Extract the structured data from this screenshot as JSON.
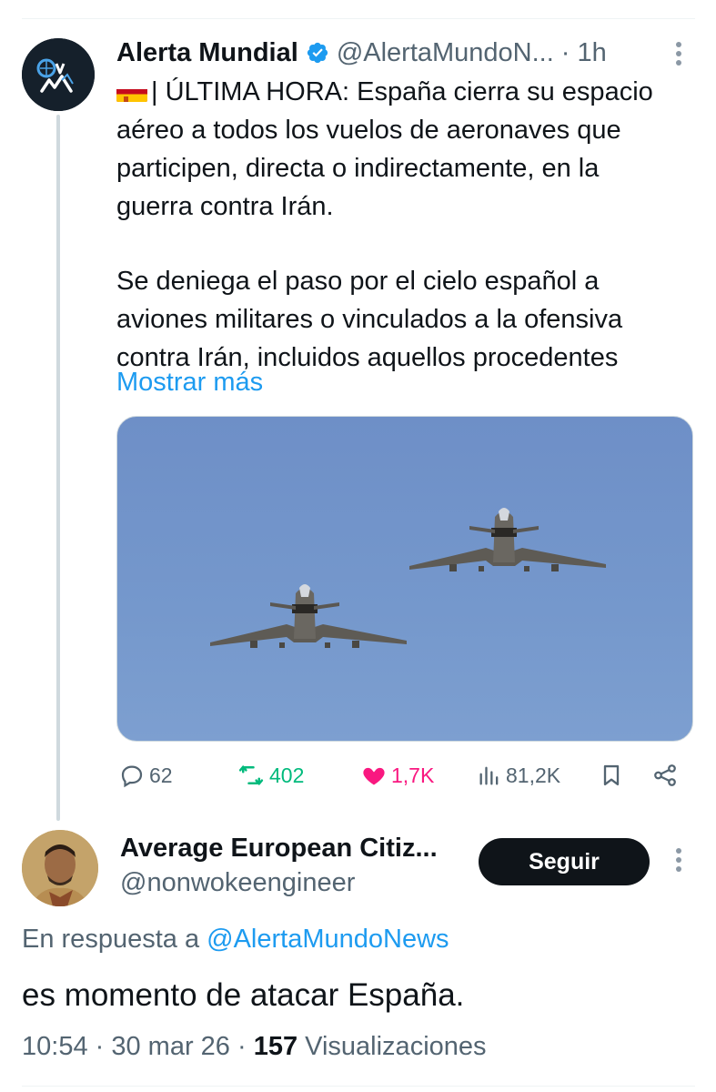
{
  "tweet": {
    "author_name": "Alerta Mundial",
    "author_handle": "@AlertaMundoN...",
    "separator": "·",
    "time": "1h",
    "text_line1": "| ÚLTIMA HORA: España cierra su espacio",
    "text_line2": "aéreo a todos los vuelos de aeronaves que",
    "text_line3": "participen, directa o indirectamente, en la",
    "text_line4": "guerra contra Irán.",
    "text_line5": "Se deniega el paso por el cielo español a",
    "text_line6": "aviones militares o vinculados a la ofensiva",
    "text_line7": "contra Irán, incluidos aquellos procedentes",
    "show_more": "Mostrar más",
    "replies": "62",
    "reposts": "402",
    "likes": "1,7K",
    "views": "81,2K"
  },
  "reply": {
    "author_name": "Average European Citiz...",
    "author_handle": "@nonwokeengineer",
    "follow_label": "Seguir",
    "reply_prefix": "En respuesta a",
    "reply_mention": "@AlertaMundoNews",
    "text": "es momento de atacar España.",
    "meta_datetime": "10:54 · 30 mar 26 ·",
    "views_count": "157",
    "views_label": "Visualizaciones"
  },
  "colors": {
    "accent": "#1d9bf0",
    "repost_active": "#00ba7c",
    "like_active": "#f91880",
    "follow_button": "#0f1419",
    "secondary_text": "#536471"
  },
  "icons": {
    "reply": "reply-icon",
    "repost": "repost-icon",
    "like": "heart-icon",
    "views": "views-icon",
    "bookmark": "bookmark-icon",
    "share": "share-icon",
    "more": "more-vertical-icon",
    "verified": "verified-badge-icon"
  }
}
